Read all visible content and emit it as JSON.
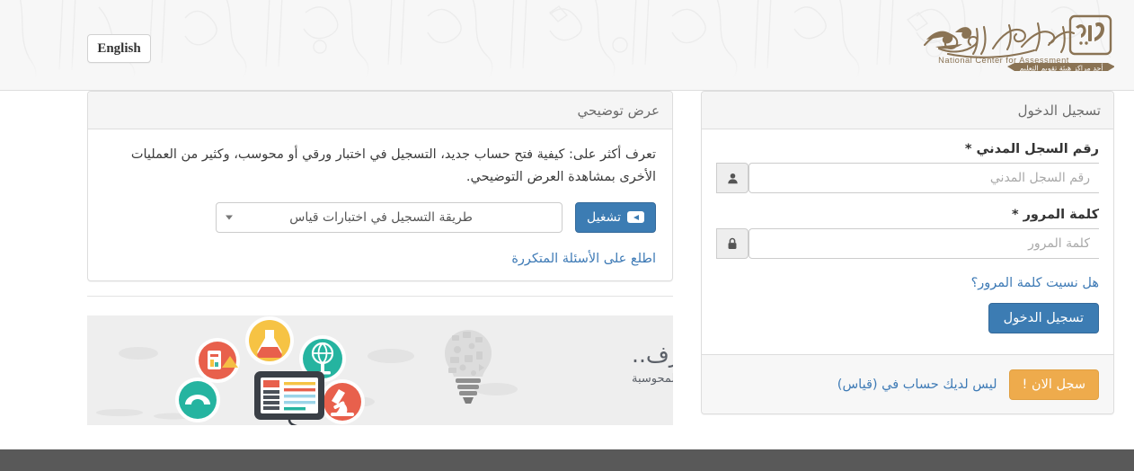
{
  "header": {
    "language_button": "English",
    "logo": {
      "arabic_name": "المركز الوطني للقياس",
      "english_name": "National Center for Assessment",
      "tagline": "أحد مراكز هيئة تقويم التعليم",
      "mark": "قياس",
      "color": "#8a7354"
    }
  },
  "demo_panel": {
    "title": "عرض توضيحي",
    "description": "تعرف أكثر على: كيفية فتح حساب جديد، التسجيل في اختبار ورقي أو محوسب، وكثير من العمليات الأخرى بمشاهدة العرض التوضيحي.",
    "select_value": "طريقة التسجيل في اختبارات قياس",
    "play_button": "تشغيل",
    "play_icon": "youtube-play-icon",
    "faq_link": "اطلع على الأسئلة المتكررة"
  },
  "banner": {
    "headline": "تعرف..",
    "subline": "على الاختبارات المحوسبة",
    "icons": [
      "chart-icon",
      "flask-icon",
      "globe-icon",
      "protractor-icon",
      "monitor-icon",
      "microscope-icon",
      "lightbulb-icon",
      "keyboard-icon"
    ]
  },
  "login_panel": {
    "title": "تسجيل الدخول",
    "fields": [
      {
        "label": "رقم السجل المدني *",
        "placeholder": "رقم السجل المدني",
        "value": "",
        "icon": "user-icon",
        "name": "civil-id"
      },
      {
        "label": "كلمة المرور *",
        "placeholder": "كلمة المرور",
        "value": "",
        "icon": "lock-icon",
        "name": "password"
      }
    ],
    "forgot_link": "هل نسيت كلمة المرور؟",
    "submit_button": "تسجيل الدخول",
    "footer_text": "ليس لديك حساب في (قياس)",
    "signup_button": "سجل الان !"
  },
  "colors": {
    "primary_blue": "#3c7cb3",
    "accent_orange": "#eeab4c",
    "link_blue": "#3f7bb6",
    "header_bg": "#f7f7f7",
    "footer_bar": "#595959",
    "logo_brown": "#8a7354"
  }
}
